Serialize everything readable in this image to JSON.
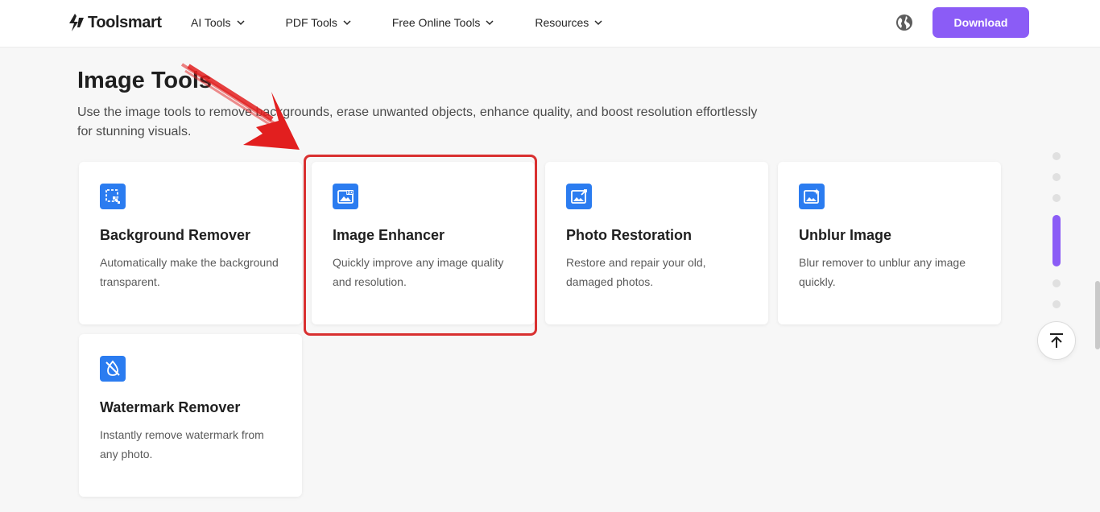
{
  "header": {
    "logo_text": "Toolsmart",
    "nav": [
      {
        "label": "AI Tools"
      },
      {
        "label": "PDF Tools"
      },
      {
        "label": "Free Online Tools"
      },
      {
        "label": "Resources"
      }
    ],
    "download_label": "Download"
  },
  "main": {
    "title": "Image Tools",
    "description": "Use the image tools to remove backgrounds, erase unwanted objects, enhance quality, and boost resolution effortlessly for stunning visuals.",
    "cards": [
      {
        "title": "Background Remover",
        "desc": "Automatically make the background transparent.",
        "icon": "background-remover-icon"
      },
      {
        "title": "Image Enhancer",
        "desc": "Quickly improve any image quality and resolution.",
        "icon": "hd-image-icon"
      },
      {
        "title": "Photo Restoration",
        "desc": "Restore and repair your old, damaged photos.",
        "icon": "photo-restore-icon"
      },
      {
        "title": "Unblur Image",
        "desc": "Blur remover to unblur any image quickly.",
        "icon": "sparkle-image-icon"
      },
      {
        "title": "Watermark Remover",
        "desc": "Instantly remove watermark from any photo.",
        "icon": "watermark-remover-icon"
      }
    ]
  },
  "colors": {
    "accent": "#8b5cf6",
    "icon_blue": "#2b7cf0",
    "highlight_red": "#d93030"
  }
}
